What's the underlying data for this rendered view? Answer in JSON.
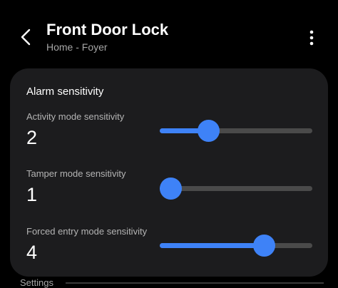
{
  "header": {
    "title": "Front Door Lock",
    "subtitle": "Home - Foyer",
    "back_icon": "chevron-left-icon",
    "more_icon": "more-vertical-icon"
  },
  "card": {
    "title": "Alarm sensitivity",
    "settings": [
      {
        "label": "Activity mode sensitivity",
        "value": "2",
        "level": 0.29
      },
      {
        "label": "Tamper mode sensitivity",
        "value": "1",
        "level": 0.0
      },
      {
        "label": "Forced entry mode sensitivity",
        "value": "4",
        "level": 0.71
      }
    ]
  },
  "footer": {
    "label": "Settings"
  },
  "colors": {
    "accent": "#3e82f7",
    "track": "#4a4a4a",
    "card_bg": "#1c1c1e",
    "page_bg": "#000000"
  }
}
